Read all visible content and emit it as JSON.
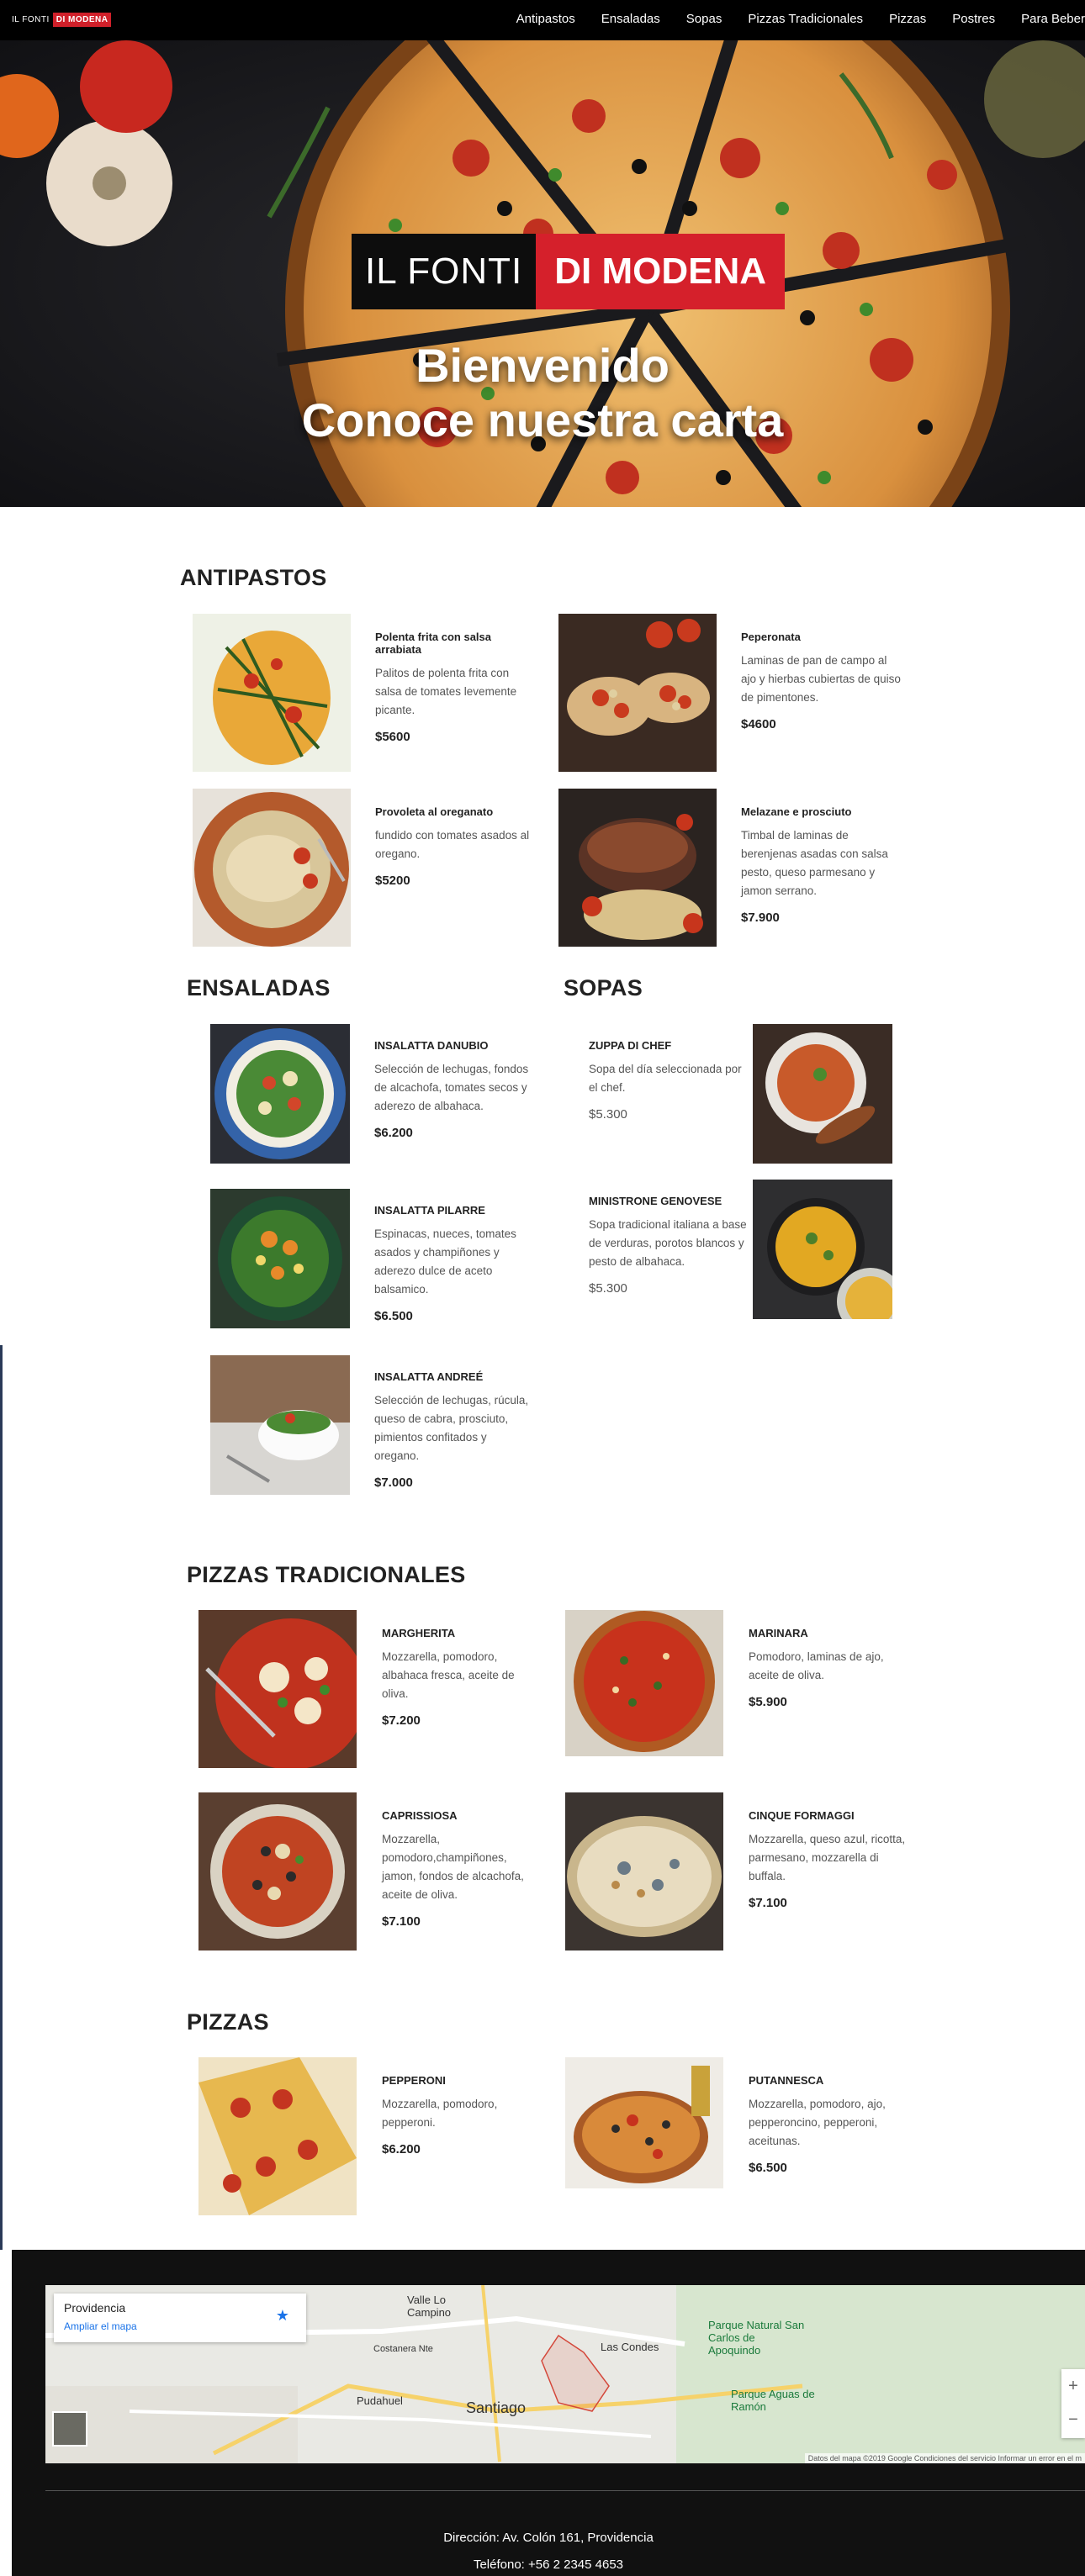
{
  "nav": {
    "logo_a": "IL FONTI",
    "logo_b": "DI MODENA",
    "items": [
      "Antipastos",
      "Ensaladas",
      "Sopas",
      "Pizzas Tradicionales",
      "Pizzas",
      "Postres",
      "Para Beber"
    ]
  },
  "hero": {
    "brand_a": "IL FONTI",
    "brand_b": "DI MODENA",
    "line1": "Bienvenido",
    "line2": "Conoce nuestra carta"
  },
  "antipastos": {
    "title": "ANTIPASTOS",
    "items": [
      {
        "name": "Polenta frita con salsa arrabiata",
        "desc": "Palitos de polenta frita con salsa de tomates levemente picante.",
        "price": "$5600"
      },
      {
        "name": "Peperonata",
        "desc": "Laminas de pan de campo al ajo y hierbas cubiertas de quiso de pimentones.",
        "price": "$4600"
      },
      {
        "name": "Provoleta al oreganato",
        "desc": "fundido con tomates asados al oregano.",
        "price": "$5200"
      },
      {
        "name": "Melazane e prosciuto",
        "desc": "Timbal de laminas de berenjenas asadas con salsa pesto, queso parmesano y jamon serrano.",
        "price": "$7.900"
      }
    ]
  },
  "ensaladas": {
    "title": "ENSALADAS",
    "items": [
      {
        "name": "INSALATTA DANUBIO",
        "desc": "Selección de lechugas, fondos de alcachofa, tomates secos y aderezo de albahaca.",
        "price": "$6.200"
      },
      {
        "name": "INSALATTA PILARRE",
        "desc": "Espinacas, nueces, tomates asados y champiñones y aderezo dulce de aceto balsamico.",
        "price": "$6.500"
      },
      {
        "name": "INSALATTA ANDREÉ",
        "desc": "Selección de lechugas, rúcula, queso de cabra, prosciuto, pimientos confitados y oregano.",
        "price": "$7.000"
      }
    ]
  },
  "sopas": {
    "title": "SOPAS",
    "items": [
      {
        "name": "ZUPPA DI CHEF",
        "desc": "Sopa del día seleccionada por el chef.",
        "price": "$5.300"
      },
      {
        "name": "MINISTRONE GENOVESE",
        "desc": "Sopa tradicional italiana a base de verduras, porotos blancos y pesto de albahaca.",
        "price": "$5.300"
      }
    ]
  },
  "tradicionales": {
    "title": "PIZZAS TRADICIONALES",
    "items": [
      {
        "name": "MARGHERITA",
        "desc": "Mozzarella, pomodoro, albahaca fresca, aceite de oliva.",
        "price": "$7.200"
      },
      {
        "name": "MARINARA",
        "desc": "Pomodoro, laminas de ajo, aceite de oliva.",
        "price": "$5.900"
      },
      {
        "name": "CAPRISSIOSA",
        "desc": "Mozzarella, pomodoro,champiñones, jamon, fondos de alcachofa, aceite de oliva.",
        "price": "$7.100"
      },
      {
        "name": "CINQUE FORMAGGI",
        "desc": "Mozzarella, queso azul, ricotta, parmesano, mozzarella di buffala.",
        "price": "$7.100"
      }
    ]
  },
  "pizzas": {
    "title": "PIZZAS",
    "items": [
      {
        "name": "PEPPERONI",
        "desc": "Mozzarella, pomodoro, pepperoni.",
        "price": "$6.200"
      },
      {
        "name": "PUTANNESCA",
        "desc": "Mozzarella, pomodoro, ajo, pepperoncino, pepperoni, aceitunas.",
        "price": "$6.500"
      }
    ]
  },
  "map": {
    "place": "Providencia",
    "link": "Ampliar el mapa",
    "labels": [
      "Valle Lo Campino",
      "Costanera Nte",
      "Las Condes",
      "Pudahuel",
      "Santiago",
      "Parque Natural San Carlos de Apoquindo",
      "Parque Aguas de Ramón"
    ],
    "footer": "Datos del mapa ©2019 Google   Condiciones del servicio   Informar un error en el m"
  },
  "footer": {
    "address": "Dirección: Av. Colón 161, Providencia",
    "phone": "Teléfono: +56 2 2345 4653"
  }
}
